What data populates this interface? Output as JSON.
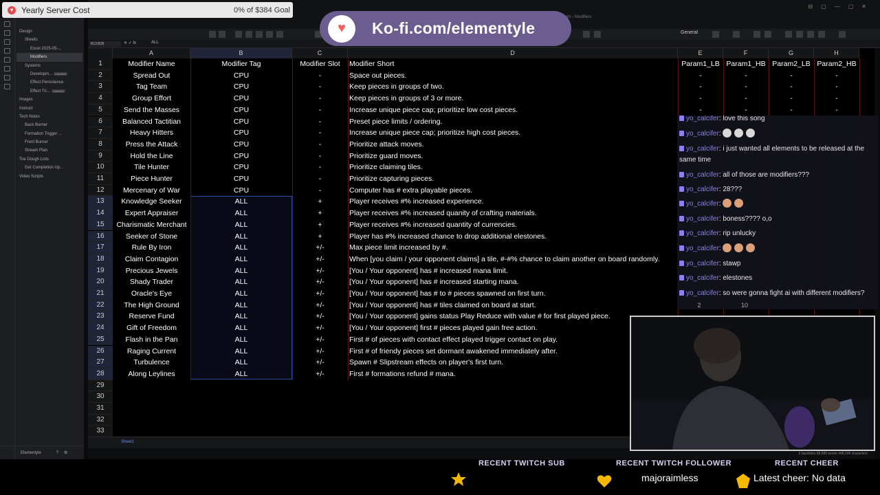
{
  "goal": {
    "title": "Yearly Server Cost",
    "progress": "0% of $384 Goal"
  },
  "kofi": {
    "text": "Ko-fi.com/elementyle"
  },
  "sidebar": {
    "items": [
      {
        "label": "Design",
        "indent": 0
      },
      {
        "label": "Sheets",
        "indent": 1
      },
      {
        "label": "Excel 2025-05-...",
        "indent": 2
      },
      {
        "label": "Modifiers",
        "indent": 2,
        "selected": true
      },
      {
        "label": "Systems",
        "indent": 1
      },
      {
        "label": "Developm...",
        "indent": 2,
        "badge": "CANVAS"
      },
      {
        "label": "Effect Persistence",
        "indent": 2
      },
      {
        "label": "Effect Tri...",
        "indent": 2,
        "badge": "CANVAS"
      },
      {
        "label": "Images",
        "indent": 0
      },
      {
        "label": "Instruct",
        "indent": 0
      },
      {
        "label": "Tech Notes",
        "indent": 0
      },
      {
        "label": "Back Burner",
        "indent": 1
      },
      {
        "label": "Formation Trigger ...",
        "indent": 1
      },
      {
        "label": "Front Burner",
        "indent": 1
      },
      {
        "label": "Stream Plan",
        "indent": 1
      },
      {
        "label": "Toe Dough Lists",
        "indent": 0
      },
      {
        "label": "Get Completion Up...",
        "indent": 1
      },
      {
        "label": "Video Scripts",
        "indent": 0
      }
    ],
    "vault": "Elementyle"
  },
  "window": {
    "crumbs": "Design  ›  Sheets  ›  Modifiers"
  },
  "toolbar": {
    "font": "General"
  },
  "formula": {
    "cellref": "B13:B28",
    "fx": "fx",
    "value": "ALL"
  },
  "columns": [
    "A",
    "B",
    "C",
    "D",
    "E",
    "F",
    "G",
    "H"
  ],
  "headers": [
    "Modifier Name",
    "Modifier Tag",
    "Modifier Slot",
    "Modifier Short",
    "Param1_LB",
    "Param1_HB",
    "Param2_LB",
    "Param2_HB"
  ],
  "rows": [
    [
      "Spread Out",
      "CPU",
      "-",
      "Space out pieces.",
      "-",
      "-",
      "-",
      "-"
    ],
    [
      "Tag Team",
      "CPU",
      "-",
      "Keep pieces in groups of two.",
      "-",
      "-",
      "-",
      "-"
    ],
    [
      "Group Effort",
      "CPU",
      "-",
      "Keep pieces in groups of 3 or more.",
      "-",
      "-",
      "-",
      "-"
    ],
    [
      "Send the Masses",
      "CPU",
      "-",
      "Increase unique piece cap; prioritize low cost pieces.",
      "-",
      "-",
      "-",
      "-"
    ],
    [
      "Balanced Tactitian",
      "CPU",
      "-",
      "Preset piece limits / ordering.",
      "",
      "",
      "",
      ""
    ],
    [
      "Heavy Hitters",
      "CPU",
      "-",
      "Increase unique piece cap; prioritize high cost pieces.",
      "",
      "",
      "",
      ""
    ],
    [
      "Press the Attack",
      "CPU",
      "-",
      "Prioritize attack moves.",
      "",
      "",
      "",
      ""
    ],
    [
      "Hold the Line",
      "CPU",
      "-",
      "Prioritize guard moves.",
      "",
      "",
      "",
      ""
    ],
    [
      "Tile Hunter",
      "CPU",
      "-",
      "Prioritize claiming tiles.",
      "",
      "",
      "",
      ""
    ],
    [
      "Piece Hunter",
      "CPU",
      "-",
      "Prioritize capturing pieces.",
      "",
      "",
      "",
      ""
    ],
    [
      "Mercenary of War",
      "CPU",
      "-",
      "Computer has # extra playable pieces.",
      "",
      "",
      "",
      ""
    ],
    [
      "Knowledge Seeker",
      "ALL",
      "+",
      "Player receives #% increased experience.",
      "",
      "",
      "",
      ""
    ],
    [
      "Expert Appraiser",
      "ALL",
      "+",
      "Player receives #% increased quanity of crafting materials.",
      "",
      "",
      "",
      ""
    ],
    [
      "Charismatic Merchant",
      "ALL",
      "+",
      "Player receives #% increased quantity of currencies.",
      "",
      "",
      "",
      ""
    ],
    [
      "Seeker of Stone",
      "ALL",
      "+",
      "Player has #% increased chance to drop additional elestones.",
      "",
      "",
      "",
      ""
    ],
    [
      "Rule By Iron",
      "ALL",
      "+/-",
      "Max piece limit increased by #.",
      "",
      "",
      "",
      ""
    ],
    [
      "Claim Contagion",
      "ALL",
      "+/-",
      "When [you claim / your opponent claims] a tile, #-#% chance to claim another on board randomly.",
      "",
      "",
      "",
      ""
    ],
    [
      "Precious Jewels",
      "ALL",
      "+/-",
      "[You / Your opponent] has # increased mana limit.",
      "",
      "",
      "",
      ""
    ],
    [
      "Shady Trader",
      "ALL",
      "+/-",
      "[You / Your opponent] has # increased starting mana.",
      "",
      "",
      "",
      ""
    ],
    [
      "Oracle's Eye",
      "ALL",
      "+/-",
      "[You / Your opponent] has # to # pieces spawned on first turn.",
      "",
      "",
      "",
      ""
    ],
    [
      "The High Ground",
      "ALL",
      "+/-",
      "[You / Your opponent] has # tiles claimed on board at start.",
      "",
      "",
      "",
      ""
    ],
    [
      "Reserve Fund",
      "ALL",
      "+/-",
      "[You / Your opponent] gains status Play Reduce with value # for first played piece.",
      "",
      "",
      "",
      ""
    ],
    [
      "Gift of Freedom",
      "ALL",
      "+/-",
      "[You / Your opponent] first # pieces played gain free action.",
      "",
      "",
      "",
      ""
    ],
    [
      "Flash in the Pan",
      "ALL",
      "+/-",
      "First # of pieces with contact effect played trigger contact on play.",
      "",
      "",
      "",
      ""
    ],
    [
      "Raging Current",
      "ALL",
      "+/-",
      "First # of friendy pieces set dormant awakened immediately after.",
      "",
      "",
      "",
      ""
    ],
    [
      "Turbulence",
      "ALL",
      "+/-",
      "Spawn # Slipstream effects on player's first turn.",
      "",
      "",
      "",
      ""
    ],
    [
      "Along Leylines",
      "ALL",
      "+/-",
      "First # formations refund # mana.",
      "",
      "",
      "",
      ""
    ]
  ],
  "row_numbers": [
    "1",
    "2",
    "3",
    "4",
    "5",
    "6",
    "7",
    "8",
    "9",
    "10",
    "11",
    "12",
    "13",
    "14",
    "15",
    "16",
    "17",
    "18",
    "19",
    "20",
    "21",
    "22",
    "23",
    "24",
    "25",
    "26",
    "27",
    "28",
    "29",
    "30",
    "31",
    "32",
    "33"
  ],
  "sheet_tab": "Sheet1",
  "status_words": "0 backlinks  68,589 words  448,006 characters",
  "chat": {
    "messages": [
      {
        "user": "yo_calcifer",
        "text": "love this song"
      },
      {
        "user": "yo_calcifer",
        "text": "",
        "emotes": [
          "skull",
          "skull",
          "skull"
        ]
      },
      {
        "user": "yo_calcifer",
        "text": "i just wanted all elements to be released at the same time"
      },
      {
        "user": "yo_calcifer",
        "text": "all of those are modifiers???"
      },
      {
        "user": "yo_calcifer",
        "text": "28???"
      },
      {
        "user": "yo_calcifer",
        "text": "",
        "emotes": [
          "face",
          "face"
        ]
      },
      {
        "user": "yo_calcifer",
        "text": "boness???? o,o"
      },
      {
        "user": "yo_calcifer",
        "text": "rip unlucky"
      },
      {
        "user": "yo_calcifer",
        "text": "",
        "emotes": [
          "face",
          "face",
          "face"
        ]
      },
      {
        "user": "yo_calcifer",
        "text": "stawp"
      },
      {
        "user": "yo_calcifer",
        "text": "elestones"
      },
      {
        "user": "yo_calcifer",
        "text": "so were gonna fight ai with different modifiers?"
      }
    ],
    "hidden_cells": [
      "2",
      "10"
    ]
  },
  "bottom": {
    "sub_label": "RECENT TWITCH SUB",
    "sub_value": "",
    "follower_label": "RECENT TWITCH FOLLOWER",
    "follower_value": "majoraimless",
    "cheer_label": "RECENT CHEER",
    "cheer_value": "Latest cheer: No data"
  },
  "colors": {
    "accent": "#8e7ef0",
    "grid_border": "#5a1414",
    "star": "#f5b800"
  }
}
